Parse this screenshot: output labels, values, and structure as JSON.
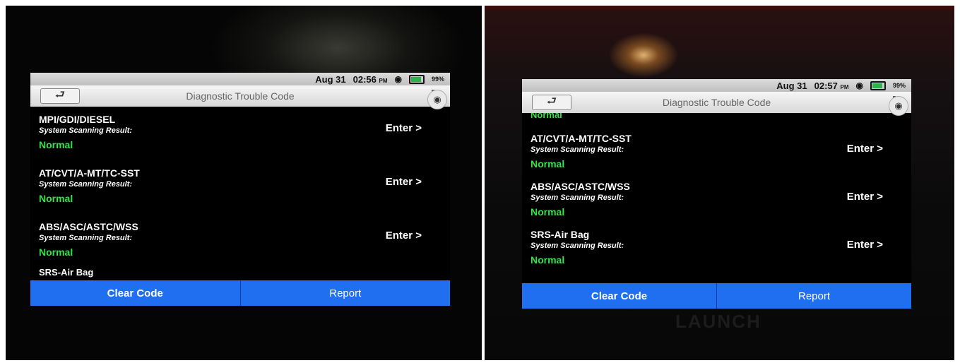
{
  "left_screen": {
    "status": {
      "date": "Aug 31",
      "time": "02:56",
      "ampm": "PM",
      "battery": "99%"
    },
    "title": "Diagnostic Trouble Code",
    "systems": [
      {
        "name": "MPI/GDI/DIESEL",
        "label": "System Scanning Result:",
        "status": "Normal",
        "enter": "Enter >"
      },
      {
        "name": "AT/CVT/A-MT/TC-SST",
        "label": "System Scanning Result:",
        "status": "Normal",
        "enter": "Enter >"
      },
      {
        "name": "ABS/ASC/ASTC/WSS",
        "label": "System Scanning Result:",
        "status": "Normal",
        "enter": "Enter >"
      }
    ],
    "partial_next": "SRS-Air Bag",
    "buttons": {
      "clear": "Clear Code",
      "report": "Report"
    }
  },
  "right_screen": {
    "status": {
      "date": "Aug 31",
      "time": "02:57",
      "ampm": "PM",
      "battery": "99%"
    },
    "title": "Diagnostic Trouble Code",
    "partial_prev_status": "Normal",
    "systems": [
      {
        "name": "AT/CVT/A-MT/TC-SST",
        "label": "System Scanning Result:",
        "status": "Normal",
        "enter": "Enter >"
      },
      {
        "name": "ABS/ASC/ASTC/WSS",
        "label": "System Scanning Result:",
        "status": "Normal",
        "enter": "Enter >"
      },
      {
        "name": "SRS-Air Bag",
        "label": "System Scanning Result:",
        "status": "Normal",
        "enter": "Enter >"
      }
    ],
    "buttons": {
      "clear": "Clear Code",
      "report": "Report"
    },
    "brand": "LAUNCH"
  },
  "colors": {
    "normal_status": "#37e14a",
    "action_bar": "#1f6ff0"
  },
  "icons": [
    "back-arrow-icon",
    "wifi-icon",
    "battery-icon",
    "flag-icon",
    "camera-icon"
  ]
}
